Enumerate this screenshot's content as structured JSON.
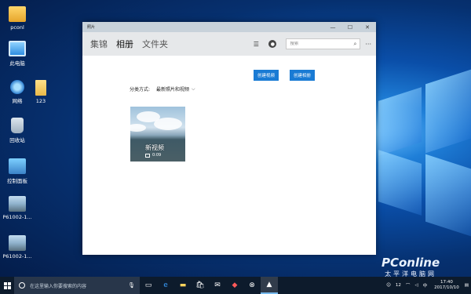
{
  "desktop": {
    "icons": [
      {
        "label": "pconl",
        "icon": "user-folder-icon"
      },
      {
        "label": "此电脑",
        "icon": "computer-icon"
      },
      {
        "label": "网络",
        "icon": "network-icon"
      },
      {
        "label": "123",
        "icon": "folder-icon"
      },
      {
        "label": "回收站",
        "icon": "recycle-bin-icon"
      },
      {
        "label": "控制面板",
        "icon": "control-panel-icon"
      },
      {
        "label": "P61002-1...",
        "icon": "image-file-icon"
      },
      {
        "label": "P61002-1...",
        "icon": "image-file-icon"
      }
    ]
  },
  "window": {
    "title": "照片",
    "controls": {
      "minimize": "—",
      "maximize": "☐",
      "close": "✕"
    },
    "tabs": [
      {
        "label": "集锦",
        "active": false
      },
      {
        "label": "相册",
        "active": true
      },
      {
        "label": "文件夹",
        "active": false
      }
    ],
    "search": {
      "placeholder": "搜索",
      "icon": "search-icon"
    },
    "more": "···",
    "buttons": {
      "create_video": "创建视频",
      "create_album": "创建相册"
    },
    "sort": {
      "label": "分类方式:",
      "value": "最新照片和视频"
    },
    "album": {
      "name": "新视频",
      "duration": "0:09"
    }
  },
  "taskbar": {
    "search_placeholder": "在这里输入你要搜索的内容",
    "time": "17:40",
    "date": "2017/10/10",
    "tray_badge": "12"
  },
  "watermark": {
    "logo": "PConline",
    "sub": "太平洋电脑网"
  },
  "colors": {
    "accent": "#1a7bd4",
    "titlebar": "#c8d2da",
    "taskbar": "#0d1b2c"
  }
}
